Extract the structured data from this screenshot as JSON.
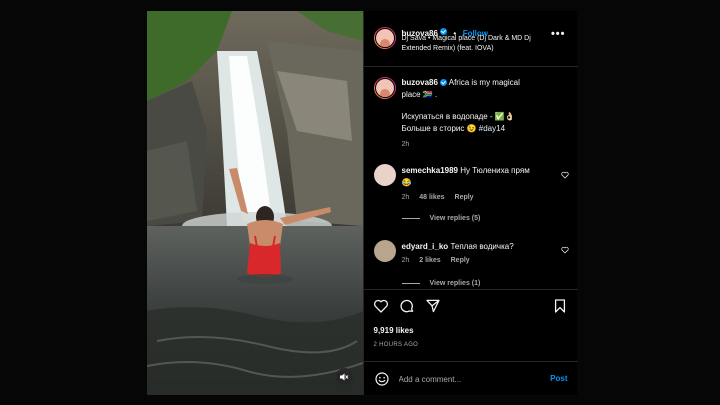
{
  "post": {
    "username": "buzova86",
    "follow_label": "Follow",
    "audio": "Dj Sava • Magical place (Dj Dark & MD Dj Extended Remix) (feat. IOVA)",
    "more_label": "•••",
    "caption": {
      "username": "buzova86",
      "line1": "Africa is my magical",
      "line2": "place 🇿🇦 .",
      "line3": "Искупаться в водопаде - ✅👌🏻",
      "line4": "Больше в сторис 😉",
      "hashtag": "#day14",
      "time": "2h"
    },
    "comments": [
      {
        "username": "semechka1989",
        "text_line1": "Ну Тюлениха прям",
        "text_line2": "😂",
        "time": "2h",
        "likes": "48 likes",
        "reply": "Reply",
        "view_replies": "View replies (5)"
      },
      {
        "username": "edyard_i_ko",
        "text_line1": "Теплая водичка?",
        "time": "2h",
        "likes": "2 likes",
        "reply": "Reply",
        "view_replies": "View replies (1)"
      }
    ],
    "likes_count": "9,919 likes",
    "timestamp": "2 HOURS AGO",
    "add_comment_placeholder": "Add a comment...",
    "post_label": "Post"
  },
  "icons": {
    "heart": "heart-icon",
    "comment": "comment-icon",
    "share": "send-icon",
    "save": "bookmark-icon",
    "emoji": "emoji-icon",
    "mute": "muted-speaker-icon",
    "more": "more-icon"
  },
  "colors": {
    "accent": "#0095f6",
    "background": "#000000",
    "divider": "#262626",
    "secondary_text": "#a8a8a8"
  }
}
